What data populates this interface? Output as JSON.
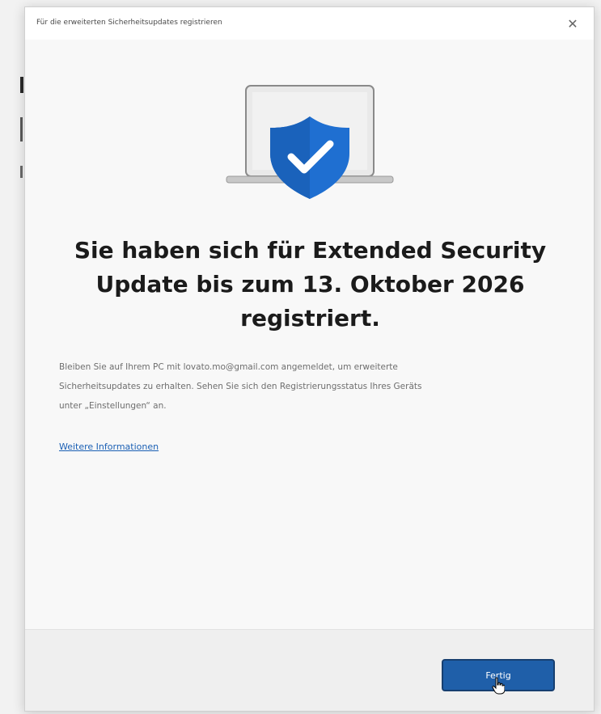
{
  "dialog": {
    "title": "Für die erweiterten Sicherheitsupdates registrieren",
    "close_glyph": "✕"
  },
  "content": {
    "heading": "Sie haben sich für Extended Security Update bis zum 13. Oktober 2026 registriert.",
    "body_line1": "Bleiben Sie auf Ihrem PC mit lovato.mo@gmail.com angemeldet, um erweiterte",
    "body_line2": "Sicherheitsupdates zu erhalten. Sehen Sie sich den Registrierungsstatus Ihres Geräts",
    "body_line3": "unter „Einstellungen“ an.",
    "link": "Weitere Informationen"
  },
  "footer": {
    "done_label": "Fertig"
  },
  "illustration": {
    "icon": "laptop-shield-check-icon",
    "shield_color": "#1f6fd1",
    "laptop_color": "#d9d9d9"
  }
}
